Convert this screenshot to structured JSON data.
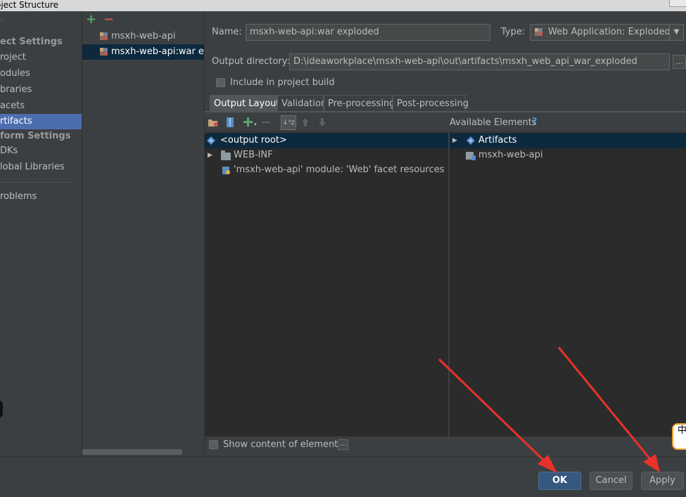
{
  "window": {
    "title": "oject Structure"
  },
  "nav": {
    "items": [
      {
        "label": "ect Settings",
        "type": "header"
      },
      {
        "label": "roject"
      },
      {
        "label": "odules"
      },
      {
        "label": "braries"
      },
      {
        "label": "acets"
      },
      {
        "label": "rtifacts",
        "selected": true
      },
      {
        "label": "form Settings",
        "type": "header"
      },
      {
        "label": "DKs"
      },
      {
        "label": "lobal Libraries"
      },
      {
        "label": "roblems"
      }
    ]
  },
  "artifacts_list": {
    "add_icon": "plus-icon",
    "remove_icon": "minus-icon",
    "items": [
      {
        "label": "msxh-web-api"
      },
      {
        "label": "msxh-web-api:war exp",
        "selected": true
      }
    ]
  },
  "form": {
    "name_label": "Name:",
    "name_value": "msxh-web-api:war exploded",
    "type_label": "Type:",
    "type_value": "Web Application: Exploded",
    "output_dir_label": "Output directory:",
    "output_dir_value": "D:\\ideaworkplace\\msxh-web-api\\out\\artifacts\\msxh_web_api_war_exploded",
    "browse_label": "...",
    "include_build_label": "Include in project build"
  },
  "tabs": [
    {
      "label": "Output Layout",
      "active": true
    },
    {
      "label": "Validation"
    },
    {
      "label": "Pre-processing"
    },
    {
      "label": "Post-processing"
    }
  ],
  "available": {
    "header": "Available Elements",
    "help": "?",
    "items": [
      {
        "label": "Artifacts"
      },
      {
        "label": "msxh-web-api"
      }
    ]
  },
  "layout_tree": {
    "items": [
      {
        "label": "<output root>"
      },
      {
        "label": "WEB-INF"
      },
      {
        "label": "'msxh-web-api' module: 'Web' facet resources"
      }
    ]
  },
  "show_content_label": "Show content of elements",
  "show_content_more": "...",
  "buttons": {
    "ok": "OK",
    "cancel": "Cancel",
    "apply": "Apply"
  },
  "ime_indicator": "中",
  "colors": {
    "accent": "#4b6eaf",
    "selection": "#0d293e",
    "ok_button": "#365880",
    "annotation_arrow": "#e8322a"
  }
}
